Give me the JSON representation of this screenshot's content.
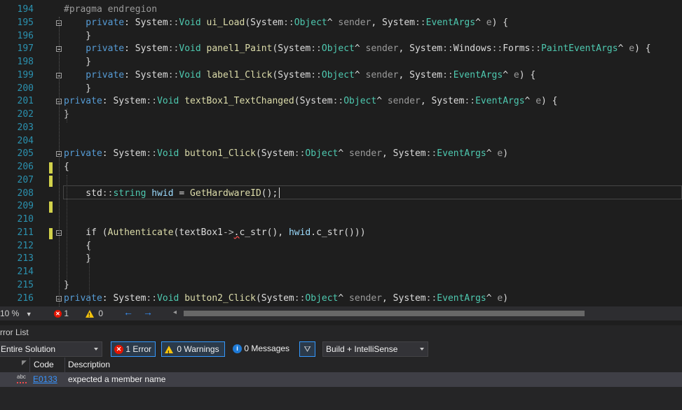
{
  "editor": {
    "lines": [
      {
        "n": "194",
        "fold": false,
        "mark": false,
        "tokens": [
          {
            "t": "#pragma endregion",
            "c": "pm"
          }
        ]
      },
      {
        "n": "195",
        "fold": true,
        "mark": false,
        "tokens": [
          {
            "t": "    private",
            "c": "kw"
          },
          {
            "t": ": ",
            "c": "pl"
          },
          {
            "t": "System",
            "c": "pl"
          },
          {
            "t": "::",
            "c": "op"
          },
          {
            "t": "Void",
            "c": "ty"
          },
          {
            "t": " ",
            "c": "pl"
          },
          {
            "t": "ui_Load",
            "c": "fn"
          },
          {
            "t": "(",
            "c": "pl"
          },
          {
            "t": "System",
            "c": "pl"
          },
          {
            "t": "::",
            "c": "op"
          },
          {
            "t": "Object",
            "c": "ty"
          },
          {
            "t": "^ ",
            "c": "pl"
          },
          {
            "t": "sender",
            "c": "pr"
          },
          {
            "t": ", ",
            "c": "pl"
          },
          {
            "t": "System",
            "c": "pl"
          },
          {
            "t": "::",
            "c": "op"
          },
          {
            "t": "EventArgs",
            "c": "ty"
          },
          {
            "t": "^ ",
            "c": "pl"
          },
          {
            "t": "e",
            "c": "pr"
          },
          {
            "t": ") {",
            "c": "pl"
          }
        ]
      },
      {
        "n": "196",
        "fold": false,
        "mark": false,
        "tokens": [
          {
            "t": "    }",
            "c": "pl"
          }
        ]
      },
      {
        "n": "197",
        "fold": true,
        "mark": false,
        "tokens": [
          {
            "t": "    private",
            "c": "kw"
          },
          {
            "t": ": ",
            "c": "pl"
          },
          {
            "t": "System",
            "c": "pl"
          },
          {
            "t": "::",
            "c": "op"
          },
          {
            "t": "Void",
            "c": "ty"
          },
          {
            "t": " ",
            "c": "pl"
          },
          {
            "t": "panel1_Paint",
            "c": "fn"
          },
          {
            "t": "(",
            "c": "pl"
          },
          {
            "t": "System",
            "c": "pl"
          },
          {
            "t": "::",
            "c": "op"
          },
          {
            "t": "Object",
            "c": "ty"
          },
          {
            "t": "^ ",
            "c": "pl"
          },
          {
            "t": "sender",
            "c": "pr"
          },
          {
            "t": ", ",
            "c": "pl"
          },
          {
            "t": "System",
            "c": "pl"
          },
          {
            "t": "::",
            "c": "op"
          },
          {
            "t": "Windows",
            "c": "pl"
          },
          {
            "t": "::",
            "c": "op"
          },
          {
            "t": "Forms",
            "c": "pl"
          },
          {
            "t": "::",
            "c": "op"
          },
          {
            "t": "PaintEventArgs",
            "c": "ty"
          },
          {
            "t": "^ ",
            "c": "pl"
          },
          {
            "t": "e",
            "c": "pr"
          },
          {
            "t": ") {",
            "c": "pl"
          }
        ]
      },
      {
        "n": "198",
        "fold": false,
        "mark": false,
        "tokens": [
          {
            "t": "    }",
            "c": "pl"
          }
        ]
      },
      {
        "n": "199",
        "fold": true,
        "mark": false,
        "tokens": [
          {
            "t": "    private",
            "c": "kw"
          },
          {
            "t": ": ",
            "c": "pl"
          },
          {
            "t": "System",
            "c": "pl"
          },
          {
            "t": "::",
            "c": "op"
          },
          {
            "t": "Void",
            "c": "ty"
          },
          {
            "t": " ",
            "c": "pl"
          },
          {
            "t": "label1_Click",
            "c": "fn"
          },
          {
            "t": "(",
            "c": "pl"
          },
          {
            "t": "System",
            "c": "pl"
          },
          {
            "t": "::",
            "c": "op"
          },
          {
            "t": "Object",
            "c": "ty"
          },
          {
            "t": "^ ",
            "c": "pl"
          },
          {
            "t": "sender",
            "c": "pr"
          },
          {
            "t": ", ",
            "c": "pl"
          },
          {
            "t": "System",
            "c": "pl"
          },
          {
            "t": "::",
            "c": "op"
          },
          {
            "t": "EventArgs",
            "c": "ty"
          },
          {
            "t": "^ ",
            "c": "pl"
          },
          {
            "t": "e",
            "c": "pr"
          },
          {
            "t": ") {",
            "c": "pl"
          }
        ]
      },
      {
        "n": "200",
        "fold": false,
        "mark": false,
        "tokens": [
          {
            "t": "    }",
            "c": "pl"
          }
        ]
      },
      {
        "n": "201",
        "fold": true,
        "mark": false,
        "tokens": [
          {
            "t": "private",
            "c": "kw"
          },
          {
            "t": ": ",
            "c": "pl"
          },
          {
            "t": "System",
            "c": "pl"
          },
          {
            "t": "::",
            "c": "op"
          },
          {
            "t": "Void",
            "c": "ty"
          },
          {
            "t": " ",
            "c": "pl"
          },
          {
            "t": "textBox1_TextChanged",
            "c": "fn"
          },
          {
            "t": "(",
            "c": "pl"
          },
          {
            "t": "System",
            "c": "pl"
          },
          {
            "t": "::",
            "c": "op"
          },
          {
            "t": "Object",
            "c": "ty"
          },
          {
            "t": "^ ",
            "c": "pl"
          },
          {
            "t": "sender",
            "c": "pr"
          },
          {
            "t": ", ",
            "c": "pl"
          },
          {
            "t": "System",
            "c": "pl"
          },
          {
            "t": "::",
            "c": "op"
          },
          {
            "t": "EventArgs",
            "c": "ty"
          },
          {
            "t": "^ ",
            "c": "pl"
          },
          {
            "t": "e",
            "c": "pr"
          },
          {
            "t": ") {",
            "c": "pl"
          }
        ]
      },
      {
        "n": "202",
        "fold": false,
        "mark": false,
        "tokens": [
          {
            "t": "}",
            "c": "pl"
          }
        ]
      },
      {
        "n": "203",
        "fold": false,
        "mark": false,
        "tokens": []
      },
      {
        "n": "204",
        "fold": false,
        "mark": false,
        "tokens": []
      },
      {
        "n": "205",
        "fold": true,
        "mark": false,
        "tokens": [
          {
            "t": "private",
            "c": "kw"
          },
          {
            "t": ": ",
            "c": "pl"
          },
          {
            "t": "System",
            "c": "pl"
          },
          {
            "t": "::",
            "c": "op"
          },
          {
            "t": "Void",
            "c": "ty"
          },
          {
            "t": " ",
            "c": "pl"
          },
          {
            "t": "button1_Click",
            "c": "fn"
          },
          {
            "t": "(",
            "c": "pl"
          },
          {
            "t": "System",
            "c": "pl"
          },
          {
            "t": "::",
            "c": "op"
          },
          {
            "t": "Object",
            "c": "ty"
          },
          {
            "t": "^ ",
            "c": "pl"
          },
          {
            "t": "sender",
            "c": "pr"
          },
          {
            "t": ", ",
            "c": "pl"
          },
          {
            "t": "System",
            "c": "pl"
          },
          {
            "t": "::",
            "c": "op"
          },
          {
            "t": "EventArgs",
            "c": "ty"
          },
          {
            "t": "^ ",
            "c": "pl"
          },
          {
            "t": "e",
            "c": "pr"
          },
          {
            "t": ")",
            "c": "pl"
          }
        ]
      },
      {
        "n": "206",
        "fold": false,
        "mark": true,
        "tokens": [
          {
            "t": "{",
            "c": "pl"
          }
        ]
      },
      {
        "n": "207",
        "fold": false,
        "mark": true,
        "tokens": []
      },
      {
        "n": "208",
        "fold": false,
        "mark": false,
        "tokens": [
          {
            "t": "    std",
            "c": "pl"
          },
          {
            "t": "::",
            "c": "op"
          },
          {
            "t": "string",
            "c": "ty"
          },
          {
            "t": " ",
            "c": "pl"
          },
          {
            "t": "hwid",
            "c": "vr"
          },
          {
            "t": " = ",
            "c": "pl"
          },
          {
            "t": "GetHardwareID",
            "c": "fn"
          },
          {
            "t": "();",
            "c": "pl"
          }
        ]
      },
      {
        "n": "209",
        "fold": false,
        "mark": true,
        "tokens": []
      },
      {
        "n": "210",
        "fold": false,
        "mark": false,
        "tokens": []
      },
      {
        "n": "211",
        "fold": true,
        "mark": true,
        "tokens": [
          {
            "t": "    if",
            "c": "pl"
          },
          {
            "t": " (",
            "c": "pl"
          },
          {
            "t": "Authenticate",
            "c": "fn"
          },
          {
            "t": "(",
            "c": "pl"
          },
          {
            "t": "textBox1",
            "c": "pl"
          },
          {
            "t": "->",
            "c": "op"
          },
          {
            "t": ".",
            "c": "sq"
          },
          {
            "t": "c_str",
            "c": "pl"
          },
          {
            "t": "(), ",
            "c": "pl"
          },
          {
            "t": "hwid",
            "c": "vr"
          },
          {
            "t": ".",
            "c": "pl"
          },
          {
            "t": "c_str",
            "c": "pl"
          },
          {
            "t": "()))",
            "c": "pl"
          }
        ]
      },
      {
        "n": "212",
        "fold": false,
        "mark": false,
        "tokens": [
          {
            "t": "    {",
            "c": "pl"
          }
        ]
      },
      {
        "n": "213",
        "fold": false,
        "mark": false,
        "tokens": [
          {
            "t": "    }",
            "c": "pl"
          }
        ]
      },
      {
        "n": "214",
        "fold": false,
        "mark": false,
        "tokens": []
      },
      {
        "n": "215",
        "fold": false,
        "mark": false,
        "tokens": [
          {
            "t": "}",
            "c": "pl"
          }
        ]
      },
      {
        "n": "216",
        "fold": true,
        "mark": false,
        "tokens": [
          {
            "t": "private",
            "c": "kw"
          },
          {
            "t": ": ",
            "c": "pl"
          },
          {
            "t": "System",
            "c": "pl"
          },
          {
            "t": "::",
            "c": "op"
          },
          {
            "t": "Void",
            "c": "ty"
          },
          {
            "t": " ",
            "c": "pl"
          },
          {
            "t": "button2_Click",
            "c": "fn"
          },
          {
            "t": "(",
            "c": "pl"
          },
          {
            "t": "System",
            "c": "pl"
          },
          {
            "t": "::",
            "c": "op"
          },
          {
            "t": "Object",
            "c": "ty"
          },
          {
            "t": "^ ",
            "c": "pl"
          },
          {
            "t": "sender",
            "c": "pr"
          },
          {
            "t": ", ",
            "c": "pl"
          },
          {
            "t": "System",
            "c": "pl"
          },
          {
            "t": "::",
            "c": "op"
          },
          {
            "t": "EventArgs",
            "c": "ty"
          },
          {
            "t": "^ ",
            "c": "pl"
          },
          {
            "t": "e",
            "c": "pr"
          },
          {
            "t": ")",
            "c": "pl"
          }
        ]
      }
    ]
  },
  "statusbar": {
    "zoom": "10 %",
    "errors": "1",
    "warnings": "0",
    "nav_back": "←",
    "nav_forward": "→",
    "scroll_left": "◂"
  },
  "error_list": {
    "title": "rror List",
    "scope": "Entire Solution",
    "errors_button": "1 Error",
    "warnings_button": "0 Warnings",
    "messages_button": "0 Messages",
    "build_filter": "Build + IntelliSense",
    "columns": {
      "code": "Code",
      "description": "Description"
    },
    "rows": [
      {
        "icon": "abc",
        "code": "E0133",
        "description": "expected a member name"
      }
    ]
  },
  "colors": {
    "background": "#1e1e1e",
    "keyword": "#569cd6",
    "type": "#4ec9b0",
    "function": "#dcdcaa",
    "variable": "#9cdcfe",
    "line_number": "#2b91af",
    "change_marker": "#d2d24b",
    "error_red": "#e51400",
    "link": "#3794ff"
  }
}
